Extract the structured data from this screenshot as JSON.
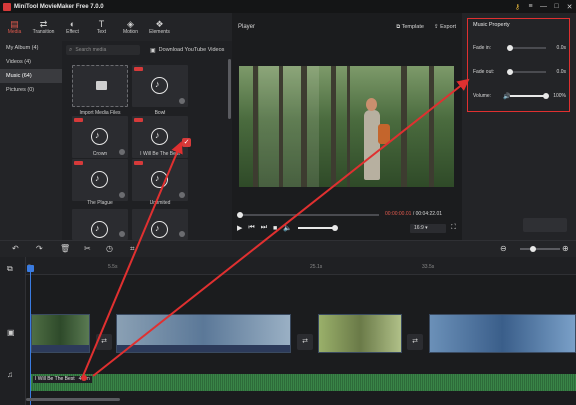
{
  "app": {
    "title": "MiniTool MovieMaker Free 7.0.0"
  },
  "window_controls": [
    "⚷",
    "≡",
    "—",
    "□",
    "✕"
  ],
  "toolbar": {
    "items": [
      {
        "label": "Media",
        "icon": "media-icon",
        "glyph": "▤",
        "active": true
      },
      {
        "label": "Transition",
        "icon": "transition-icon",
        "glyph": "⇄",
        "active": false
      },
      {
        "label": "Effect",
        "icon": "effect-icon",
        "glyph": "◐",
        "active": false
      },
      {
        "label": "Text",
        "icon": "text-icon",
        "glyph": "T",
        "active": false
      },
      {
        "label": "Motion",
        "icon": "motion-icon",
        "glyph": "◈",
        "active": false
      },
      {
        "label": "Elements",
        "icon": "elements-icon",
        "glyph": "❖",
        "active": false
      }
    ]
  },
  "left_nav": {
    "items": [
      {
        "label": "My Album (4)",
        "active": false
      },
      {
        "label": "Videos (4)",
        "active": false
      },
      {
        "label": "Music (64)",
        "active": true
      },
      {
        "label": "Pictures (0)",
        "active": false
      }
    ]
  },
  "media": {
    "search_placeholder": "Search media",
    "download_label": "Download YouTube Videos",
    "cards": [
      {
        "label": "Import Media Files",
        "kind": "import"
      },
      {
        "label": "Bowl",
        "kind": "music",
        "new": true
      },
      {
        "label": "Crown",
        "kind": "music",
        "new": true
      },
      {
        "label": "I Will Be The Best",
        "kind": "music",
        "new": true,
        "selected": true
      },
      {
        "label": "The Plague",
        "kind": "music",
        "new": true
      },
      {
        "label": "Unlimited",
        "kind": "music",
        "new": true
      },
      {
        "label": "",
        "kind": "music",
        "new": false
      },
      {
        "label": "",
        "kind": "music",
        "new": false
      }
    ]
  },
  "player": {
    "title": "Player",
    "template_label": "Template",
    "export_label": "Export",
    "current_time": "00:00:00.01",
    "total_time": "/ 00:04:22.01",
    "ratio": "16:9"
  },
  "music_property": {
    "title": "Music Property",
    "fade_in_label": "Fade in:",
    "fade_in_value": "0.0s",
    "fade_out_label": "Fade out:",
    "fade_out_value": "0.0s",
    "volume_label": "Volume:",
    "volume_value": "100%",
    "volume_level": 1.0,
    "fade_in_level": 0.0,
    "fade_out_level": 0.0
  },
  "timeline": {
    "ticks": [
      "0s",
      "5.5s",
      "25.1s",
      "33.5s"
    ],
    "music_clip": {
      "label": "I Will Be The Best",
      "duration": "4.4m"
    }
  },
  "colors": {
    "accent": "#e05a4e",
    "annotation": "#e03030",
    "playhead": "#3a7be0"
  }
}
